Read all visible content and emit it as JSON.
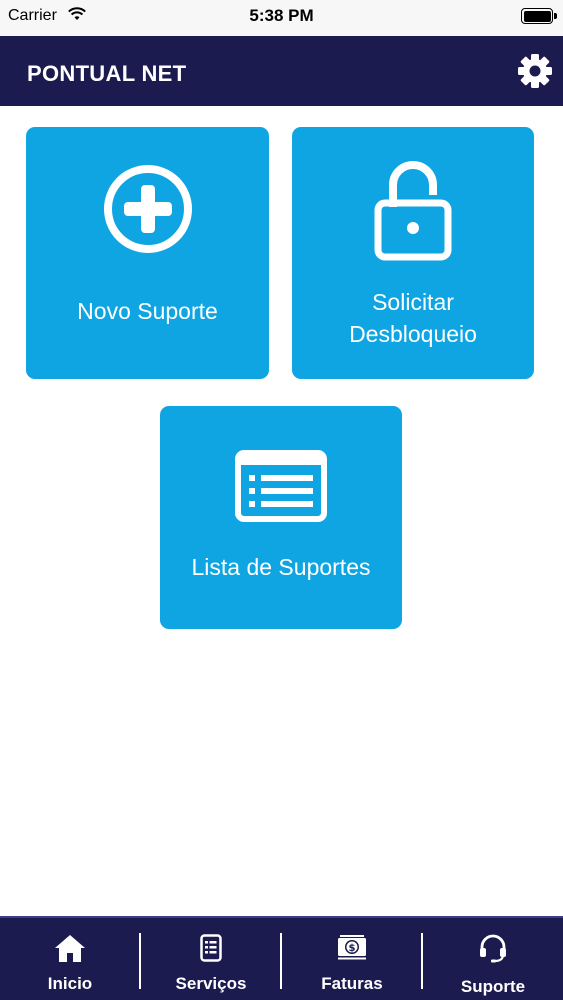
{
  "status_bar": {
    "carrier": "Carrier",
    "time": "5:38 PM"
  },
  "header": {
    "title": "PONTUAL NET"
  },
  "tiles": [
    {
      "label": "Novo Suporte"
    },
    {
      "label": "Solicitar\nDesbloqueio"
    },
    {
      "label": "Lista de Suportes"
    }
  ],
  "tabs": [
    {
      "label": "Inicio",
      "icon": "home-icon"
    },
    {
      "label": "Serviços",
      "icon": "document-icon"
    },
    {
      "label": "Faturas",
      "icon": "money-icon"
    },
    {
      "label": "Suporte",
      "icon": "headset-icon"
    }
  ],
  "colors": {
    "navy": "#1c1b50",
    "tile_blue": "#0fa5e2"
  }
}
